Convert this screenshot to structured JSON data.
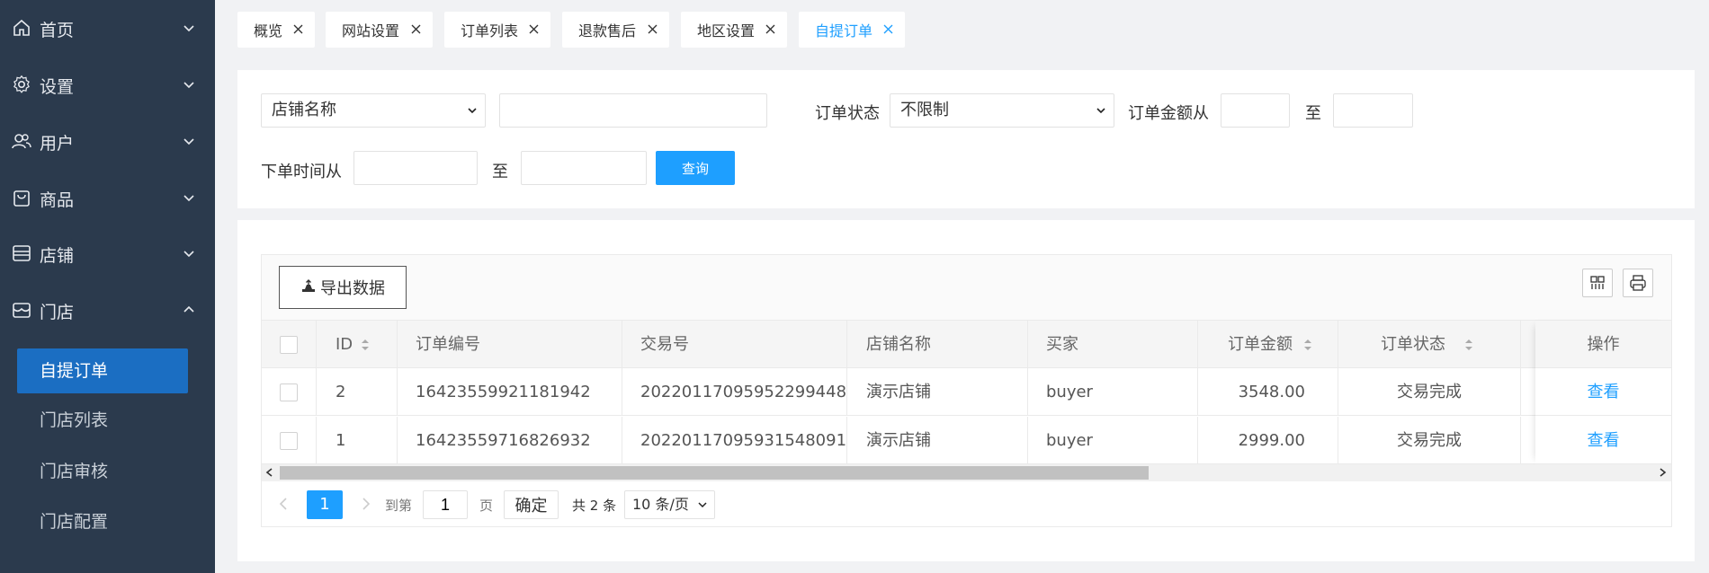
{
  "sidebar": {
    "items": [
      {
        "label": "首页",
        "icon": "home-icon",
        "expanded": false
      },
      {
        "label": "设置",
        "icon": "gear-icon",
        "expanded": false
      },
      {
        "label": "用户",
        "icon": "users-icon",
        "expanded": false
      },
      {
        "label": "商品",
        "icon": "bag-icon",
        "expanded": false
      },
      {
        "label": "店铺",
        "icon": "shop-icon",
        "expanded": false
      },
      {
        "label": "门店",
        "icon": "store-icon",
        "expanded": true
      }
    ],
    "subitems": [
      {
        "label": "自提订单",
        "active": true
      },
      {
        "label": "门店列表",
        "active": false
      },
      {
        "label": "门店审核",
        "active": false
      },
      {
        "label": "门店配置",
        "active": false
      }
    ]
  },
  "tabs": [
    {
      "label": "概览",
      "active": false
    },
    {
      "label": "网站设置",
      "active": false
    },
    {
      "label": "订单列表",
      "active": false
    },
    {
      "label": "退款售后",
      "active": false
    },
    {
      "label": "地区设置",
      "active": false
    },
    {
      "label": "自提订单",
      "active": true
    }
  ],
  "filters": {
    "shop_select": "店铺名称",
    "keyword_value": "",
    "status_label": "订单状态",
    "status_select": "不限制",
    "amount_label": "订单金额从",
    "to_label": "至",
    "time_label": "下单时间从",
    "query_button": "查询"
  },
  "table": {
    "export_button": "导出数据",
    "columns": [
      "ID",
      "订单编号",
      "交易号",
      "店铺名称",
      "买家",
      "订单金额",
      "订单状态",
      "操作"
    ],
    "rows": [
      {
        "id": "2",
        "order_no": "16423559921181942",
        "trade_no": "20220117095952299448",
        "shop": "演示店铺",
        "buyer": "buyer",
        "amount": "3548.00",
        "status": "交易完成",
        "action": "查看"
      },
      {
        "id": "1",
        "order_no": "16423559716826932",
        "trade_no": "20220117095931548091",
        "shop": "演示店铺",
        "buyer": "buyer",
        "amount": "2999.00",
        "status": "交易完成",
        "action": "查看"
      }
    ]
  },
  "pager": {
    "current": "1",
    "goto_label": "到第",
    "goto_value": "1",
    "page_label": "页",
    "confirm": "确定",
    "total": "共 2 条",
    "page_size": "10 条/页"
  },
  "colors": {
    "sidebar_bg": "#2b3a4d",
    "active_blue": "#1b6ec2",
    "accent": "#1e9fff"
  }
}
